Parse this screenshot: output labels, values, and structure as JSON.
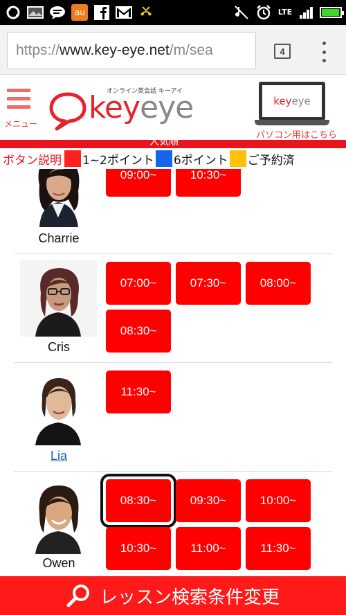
{
  "status_bar": {
    "left_icons": [
      "sync-icon",
      "image-icon",
      "chat-icon",
      "au-app-icon",
      "facebook-icon",
      "gmail-icon",
      "missed-call-icon"
    ],
    "right_icons": [
      "mute-icon",
      "alarm-icon"
    ],
    "network": "LTE",
    "battery_level": 0.95
  },
  "browser": {
    "url_scheme": "https://",
    "url_host": "www.key-eye.net",
    "url_path": "/m/sea",
    "tab_count": "4"
  },
  "header": {
    "menu_label": "メニュー",
    "logo_tagline": "オンライン英会話 キーアイ",
    "logo_key": "key",
    "logo_eye": "eye",
    "pc_link_label": "パソコン用はこちら",
    "pc_logo_key": "key",
    "pc_logo_eye": "eye"
  },
  "sort_label": "人気順",
  "legend": {
    "title": "ボタン説明",
    "items": [
      {
        "color": "#ff2020",
        "label": "1~2ポイント"
      },
      {
        "color": "#1565e8",
        "label": "6ポイント"
      },
      {
        "color": "#ffc107",
        "label": "ご予約済"
      }
    ]
  },
  "teachers": [
    {
      "name": "Charrie",
      "link": false,
      "slots": [
        "09:00~",
        "10:30~"
      ]
    },
    {
      "name": "Cris",
      "link": false,
      "slots": [
        "07:00~",
        "07:30~",
        "08:00~",
        "08:30~"
      ]
    },
    {
      "name": "Lia",
      "link": true,
      "slots": [
        "11:30~"
      ]
    },
    {
      "name": "Owen",
      "link": false,
      "slots": [
        "08:30~",
        "09:30~",
        "10:00~",
        "10:30~",
        "11:00~",
        "11:30~"
      ]
    }
  ],
  "search_button": {
    "label": "レッスン検索条件変更"
  },
  "colors": {
    "brand_red": "#ff0000",
    "booked_yellow": "#ffc107",
    "points6_blue": "#1565e8"
  }
}
